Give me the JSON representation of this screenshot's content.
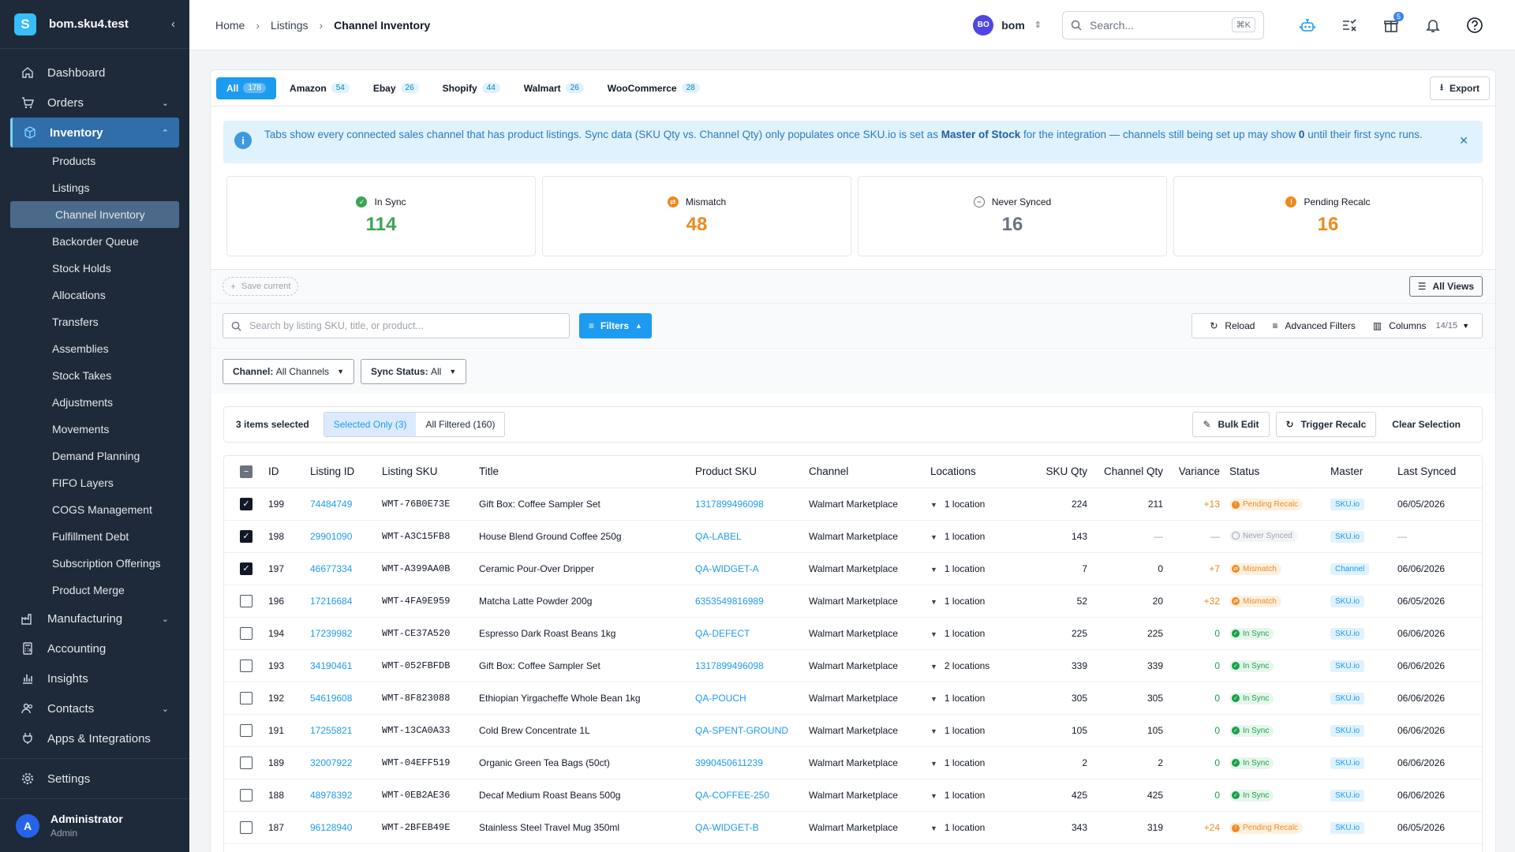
{
  "app": {
    "name": "bom.sku4.test",
    "logo_letter": "S"
  },
  "sidebar": {
    "items": [
      {
        "label": "Dashboard",
        "icon": "home-icon"
      },
      {
        "label": "Orders",
        "icon": "cart-icon"
      },
      {
        "label": "Inventory",
        "icon": "box-icon"
      }
    ],
    "inventory_sub": [
      "Products",
      "Listings",
      "Channel Inventory",
      "Backorder Queue",
      "Stock Holds",
      "Allocations",
      "Transfers",
      "Assemblies",
      "Stock Takes",
      "Adjustments",
      "Movements",
      "Demand Planning",
      "FIFO Layers",
      "COGS Management",
      "Fulfillment Debt",
      "Subscription Offerings",
      "Product Merge"
    ],
    "lower_items": [
      "Manufacturing",
      "Accounting",
      "Insights",
      "Contacts",
      "Apps & Integrations"
    ],
    "settings": "Settings",
    "user": {
      "initial": "A",
      "name": "Administrator",
      "role": "Admin"
    }
  },
  "topbar": {
    "breadcrumb": [
      "Home",
      "Listings",
      "Channel Inventory"
    ],
    "account_initials": "BO",
    "account_name": "bom",
    "search_placeholder": "Search...",
    "search_kbd": "⌘K",
    "gift_badge": "5"
  },
  "tabs": [
    {
      "label": "All",
      "count": "178"
    },
    {
      "label": "Amazon",
      "count": "54"
    },
    {
      "label": "Ebay",
      "count": "26"
    },
    {
      "label": "Shopify",
      "count": "44"
    },
    {
      "label": "Walmart",
      "count": "26"
    },
    {
      "label": "WooCommerce",
      "count": "28"
    }
  ],
  "export_label": "Export",
  "info": {
    "before": "Tabs show every connected sales channel that has product listings. Sync data (SKU Qty vs. Channel Qty) only populates once SKU.io is set as ",
    "bold1": "Master of Stock",
    "middle": " for the integration — channels still being set up may show ",
    "bold2": "0",
    "after": " until their first sync runs."
  },
  "stats": [
    {
      "label": "In Sync",
      "value": "114",
      "color": "#3aa655"
    },
    {
      "label": "Mismatch",
      "value": "48",
      "color": "#ec8a1c"
    },
    {
      "label": "Never Synced",
      "value": "16",
      "color": "#6b7280"
    },
    {
      "label": "Pending Recalc",
      "value": "16",
      "color": "#ec8a1c"
    }
  ],
  "views": {
    "save_current": "Save current",
    "all_views": "All Views"
  },
  "search_listing_placeholder": "Search by listing SKU, title, or product...",
  "filters_label": "Filters",
  "tools": {
    "reload": "Reload",
    "advanced": "Advanced Filters",
    "columns": "Columns",
    "columns_count": "14/15"
  },
  "chips": [
    {
      "key": "Channel:",
      "value": "All Channels"
    },
    {
      "key": "Sync Status:",
      "value": "All"
    }
  ],
  "selection": {
    "count_text": "3 items selected",
    "selected_only": "Selected Only (3)",
    "all_filtered": "All Filtered (160)",
    "bulk_edit": "Bulk Edit",
    "trigger_recalc": "Trigger Recalc",
    "clear": "Clear Selection"
  },
  "columns": [
    "ID",
    "Listing ID",
    "Listing SKU",
    "Title",
    "Product SKU",
    "Channel",
    "Locations",
    "SKU Qty",
    "Channel Qty",
    "Variance",
    "Status",
    "Master",
    "Last Synced"
  ],
  "rows": [
    {
      "checked": true,
      "id": "199",
      "listing_id": "74484749",
      "sku": "WMT-76B0E73E",
      "title": "Gift Box: Coffee Sampler Set",
      "product_sku": "1317899496098",
      "channel": "Walmart Marketplace",
      "locations": "1 location",
      "sku_qty": "224",
      "channel_qty": "211",
      "variance": "+13",
      "status": "Pending Recalc",
      "master": "SKU.io",
      "last": "06/05/2026"
    },
    {
      "checked": true,
      "id": "198",
      "listing_id": "29901090",
      "sku": "WMT-A3C15FB8",
      "title": "House Blend Ground Coffee 250g",
      "product_sku": "QA-LABEL",
      "channel": "Walmart Marketplace",
      "locations": "1 location",
      "sku_qty": "143",
      "channel_qty": "—",
      "variance": "—",
      "status": "Never Synced",
      "master": "SKU.io",
      "last": "—"
    },
    {
      "checked": true,
      "id": "197",
      "listing_id": "46677334",
      "sku": "WMT-A399AA0B",
      "title": "Ceramic Pour-Over Dripper",
      "product_sku": "QA-WIDGET-A",
      "channel": "Walmart Marketplace",
      "locations": "1 location",
      "sku_qty": "7",
      "channel_qty": "0",
      "variance": "+7",
      "status": "Mismatch",
      "master": "Channel",
      "last": "06/06/2026"
    },
    {
      "checked": false,
      "id": "196",
      "listing_id": "17216684",
      "sku": "WMT-4FA9E959",
      "title": "Matcha Latte Powder 200g",
      "product_sku": "6353549816989",
      "channel": "Walmart Marketplace",
      "locations": "1 location",
      "sku_qty": "52",
      "channel_qty": "20",
      "variance": "+32",
      "status": "Mismatch",
      "master": "SKU.io",
      "last": "06/05/2026"
    },
    {
      "checked": false,
      "id": "194",
      "listing_id": "17239982",
      "sku": "WMT-CE37A520",
      "title": "Espresso Dark Roast Beans 1kg",
      "product_sku": "QA-DEFECT",
      "channel": "Walmart Marketplace",
      "locations": "1 location",
      "sku_qty": "225",
      "channel_qty": "225",
      "variance": "0",
      "status": "In Sync",
      "master": "SKU.io",
      "last": "06/06/2026"
    },
    {
      "checked": false,
      "id": "193",
      "listing_id": "34190461",
      "sku": "WMT-052FBFDB",
      "title": "Gift Box: Coffee Sampler Set",
      "product_sku": "1317899496098",
      "channel": "Walmart Marketplace",
      "locations": "2 locations",
      "sku_qty": "339",
      "channel_qty": "339",
      "variance": "0",
      "status": "In Sync",
      "master": "SKU.io",
      "last": "06/06/2026"
    },
    {
      "checked": false,
      "id": "192",
      "listing_id": "54619608",
      "sku": "WMT-8F823088",
      "title": "Ethiopian Yirgacheffe Whole Bean 1kg",
      "product_sku": "QA-POUCH",
      "channel": "Walmart Marketplace",
      "locations": "1 location",
      "sku_qty": "305",
      "channel_qty": "305",
      "variance": "0",
      "status": "In Sync",
      "master": "SKU.io",
      "last": "06/06/2026"
    },
    {
      "checked": false,
      "id": "191",
      "listing_id": "17255821",
      "sku": "WMT-13CA0A33",
      "title": "Cold Brew Concentrate 1L",
      "product_sku": "QA-SPENT-GROUND",
      "channel": "Walmart Marketplace",
      "locations": "1 location",
      "sku_qty": "105",
      "channel_qty": "105",
      "variance": "0",
      "status": "In Sync",
      "master": "SKU.io",
      "last": "06/06/2026"
    },
    {
      "checked": false,
      "id": "189",
      "listing_id": "32007922",
      "sku": "WMT-04EFF519",
      "title": "Organic Green Tea Bags (50ct)",
      "product_sku": "3990450611239",
      "channel": "Walmart Marketplace",
      "locations": "1 location",
      "sku_qty": "2",
      "channel_qty": "2",
      "variance": "0",
      "status": "In Sync",
      "master": "SKU.io",
      "last": "06/06/2026"
    },
    {
      "checked": false,
      "id": "188",
      "listing_id": "48978392",
      "sku": "WMT-0EB2AE36",
      "title": "Decaf Medium Roast Beans 500g",
      "product_sku": "QA-COFFEE-250",
      "channel": "Walmart Marketplace",
      "locations": "1 location",
      "sku_qty": "425",
      "channel_qty": "425",
      "variance": "0",
      "status": "In Sync",
      "master": "SKU.io",
      "last": "06/06/2026"
    },
    {
      "checked": false,
      "id": "187",
      "listing_id": "96128940",
      "sku": "WMT-2BFEB49E",
      "title": "Stainless Steel Travel Mug 350ml",
      "product_sku": "QA-WIDGET-B",
      "channel": "Walmart Marketplace",
      "locations": "1 location",
      "sku_qty": "343",
      "channel_qty": "319",
      "variance": "+24",
      "status": "Pending Recalc",
      "master": "SKU.io",
      "last": "06/05/2026"
    }
  ]
}
